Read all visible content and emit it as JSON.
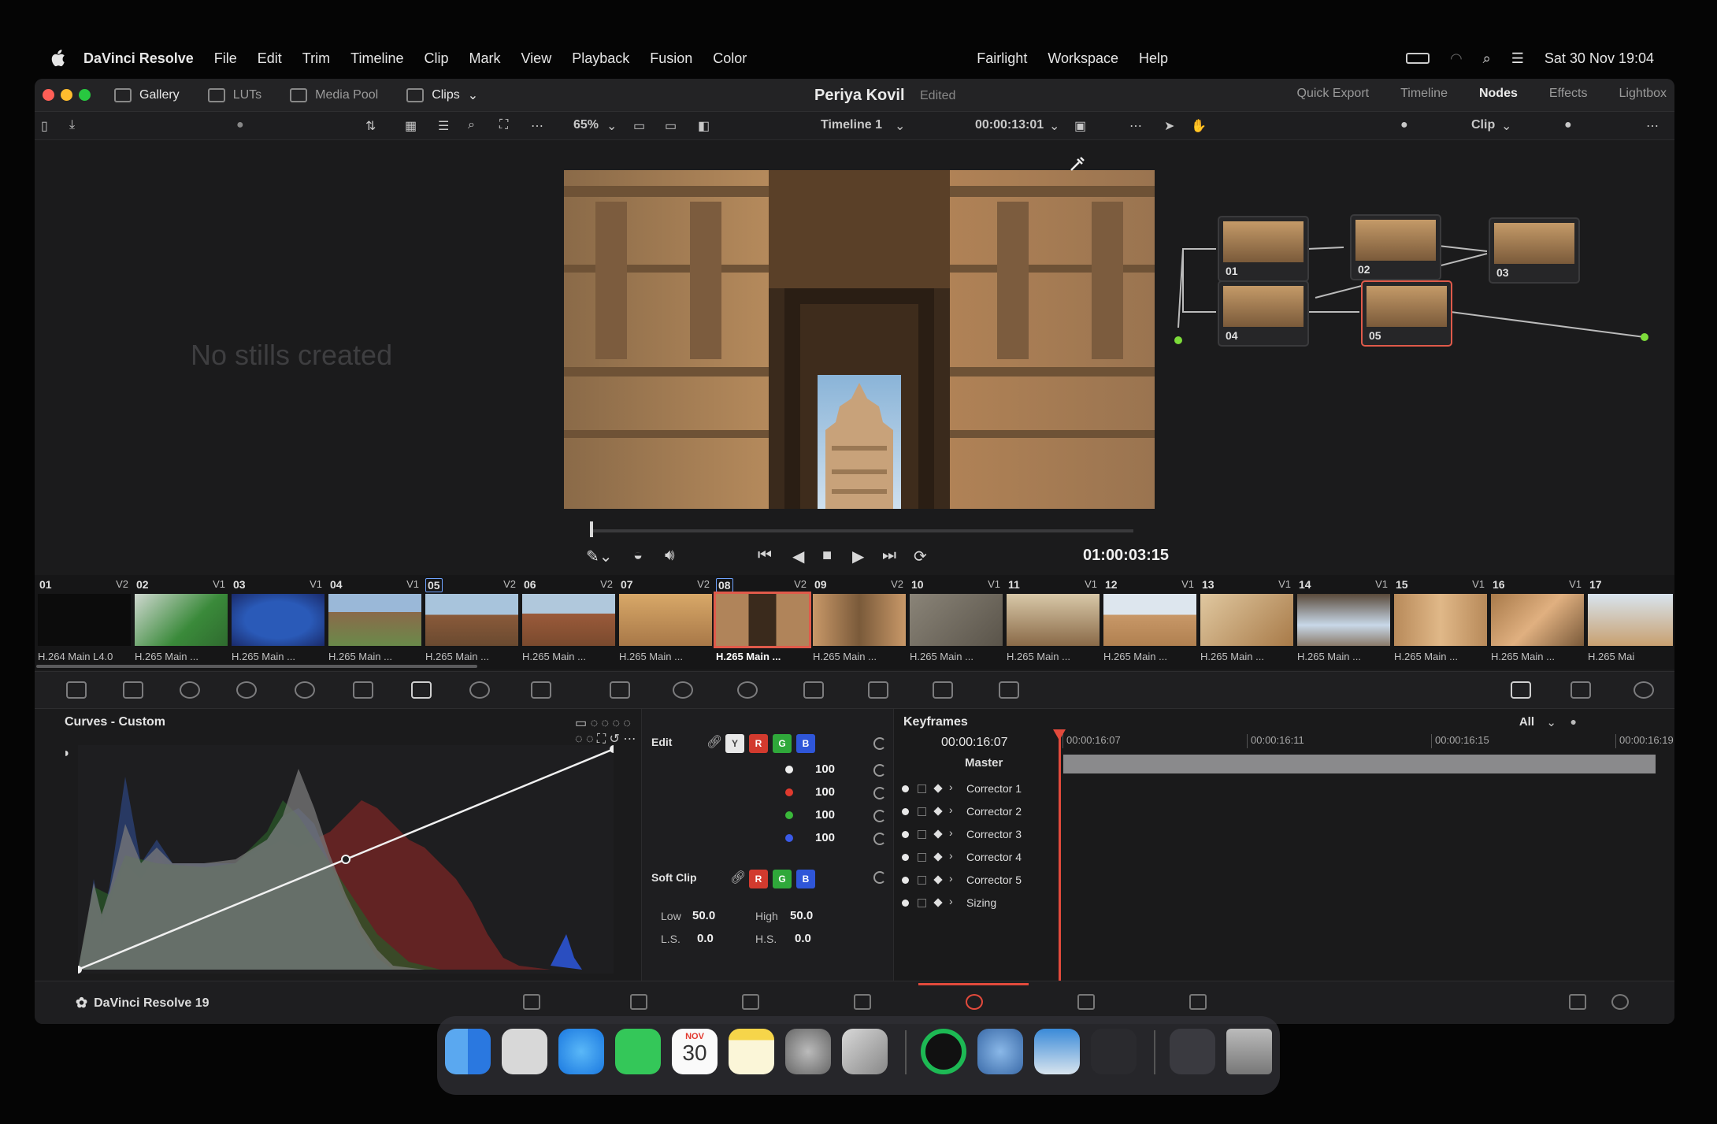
{
  "menubar": {
    "app_name": "DaVinci Resolve",
    "items": [
      "File",
      "Edit",
      "Trim",
      "Timeline",
      "Clip",
      "Mark",
      "View",
      "Playback",
      "Fusion",
      "Color",
      "Fairlight",
      "Workspace",
      "Help"
    ],
    "datetime": "Sat 30 Nov  19:04"
  },
  "titlebar": {
    "left_tabs": [
      "Gallery",
      "LUTs",
      "Media Pool",
      "Clips"
    ],
    "project_name": "Periya Kovil",
    "project_status": "Edited",
    "right_tabs": [
      "Quick Export",
      "Timeline",
      "Nodes",
      "Effects",
      "Lightbox"
    ],
    "active_right_tab": "Nodes"
  },
  "toolbar": {
    "zoom": "65%",
    "timeline_name": "Timeline 1",
    "source_timecode": "00:00:13:01",
    "node_mode": "Clip"
  },
  "gallery": {
    "empty_message": "No stills created"
  },
  "viewer": {
    "timecode": "01:00:03:15",
    "playhead_fraction": 0.0
  },
  "nodes": [
    {
      "label": "01"
    },
    {
      "label": "02"
    },
    {
      "label": "03"
    },
    {
      "label": "04"
    },
    {
      "label": "05"
    }
  ],
  "clips": [
    {
      "num": "01",
      "track": "V2",
      "codec": "H.264 Main L4.0"
    },
    {
      "num": "02",
      "track": "V1",
      "codec": "H.265 Main ..."
    },
    {
      "num": "03",
      "track": "V1",
      "codec": "H.265 Main ..."
    },
    {
      "num": "04",
      "track": "V1",
      "codec": "H.265 Main ..."
    },
    {
      "num": "05",
      "track": "V2",
      "codec": "H.265 Main ..."
    },
    {
      "num": "06",
      "track": "V2",
      "codec": "H.265 Main ..."
    },
    {
      "num": "07",
      "track": "V2",
      "codec": "H.265 Main ..."
    },
    {
      "num": "08",
      "track": "V2",
      "codec": "H.265 Main ..."
    },
    {
      "num": "09",
      "track": "V2",
      "codec": "H.265 Main ..."
    },
    {
      "num": "10",
      "track": "V1",
      "codec": "H.265 Main ..."
    },
    {
      "num": "11",
      "track": "V1",
      "codec": "H.265 Main ..."
    },
    {
      "num": "12",
      "track": "V1",
      "codec": "H.265 Main ..."
    },
    {
      "num": "13",
      "track": "V1",
      "codec": "H.265 Main ..."
    },
    {
      "num": "14",
      "track": "V1",
      "codec": "H.265 Main ..."
    },
    {
      "num": "15",
      "track": "V1",
      "codec": "H.265 Main ..."
    },
    {
      "num": "16",
      "track": "V1",
      "codec": "H.265 Main ..."
    },
    {
      "num": "17",
      "track": "",
      "codec": "H.265 Mai"
    }
  ],
  "curves": {
    "title": "Curves - Custom",
    "edit_label": "Edit",
    "channel_chips": [
      "Y",
      "R",
      "G",
      "B"
    ],
    "intensity_values": [
      "100",
      "100",
      "100",
      "100"
    ],
    "soft_clip_label": "Soft Clip",
    "soft_clip_chips": [
      "R",
      "G",
      "B"
    ],
    "low_label": "Low",
    "low_value": "50.0",
    "high_label": "High",
    "high_value": "50.0",
    "ls_label": "L.S.",
    "ls_value": "0.0",
    "hs_label": "H.S.",
    "hs_value": "0.0"
  },
  "keyframes": {
    "title": "Keyframes",
    "filter": "All",
    "current_timecode": "00:00:16:07",
    "ruler": [
      "00:00:16:07",
      "00:00:16:11",
      "00:00:16:15",
      "00:00:16:19"
    ],
    "master_label": "Master",
    "rows": [
      "Corrector 1",
      "Corrector 2",
      "Corrector 3",
      "Corrector 4",
      "Corrector 5",
      "Sizing"
    ]
  },
  "pagebar": {
    "app_version": "DaVinci Resolve 19"
  },
  "dock": {
    "calendar_month": "NOV",
    "calendar_day": "30"
  },
  "colors": {
    "accent_red": "#e24a3c",
    "connector_green": "#7ddc3a",
    "connector_blue": "#3aa6e8"
  }
}
